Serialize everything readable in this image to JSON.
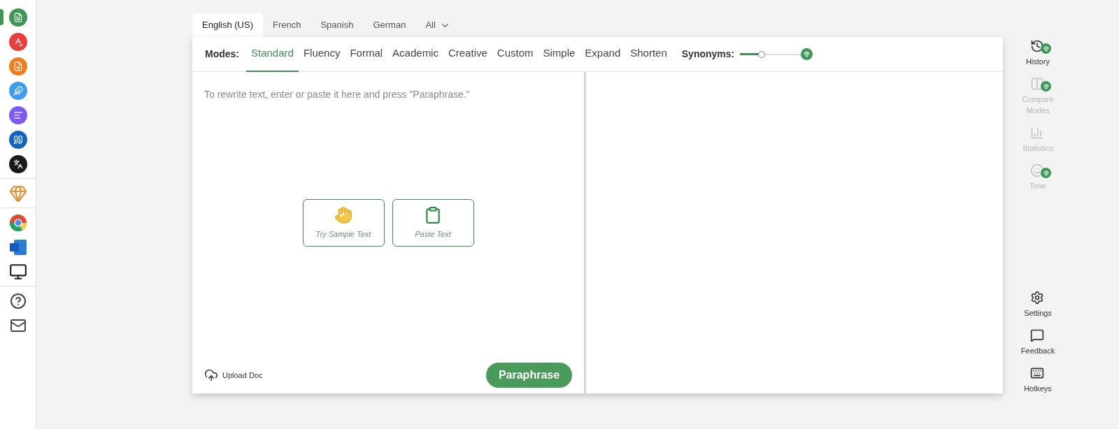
{
  "sidebar": {
    "groups": [
      {
        "items": [
          {
            "kind": "paraphraser",
            "selected": true
          },
          {
            "kind": "grammar",
            "selected": false
          },
          {
            "kind": "plagiarism",
            "selected": false
          },
          {
            "kind": "cowriter",
            "selected": false
          },
          {
            "kind": "summarizer",
            "selected": false
          },
          {
            "kind": "citation",
            "selected": false
          },
          {
            "kind": "translator",
            "selected": false
          }
        ]
      },
      {
        "items": [
          {
            "kind": "premium",
            "selected": false
          }
        ]
      },
      {
        "items": [
          {
            "kind": "chrome",
            "selected": false
          },
          {
            "kind": "word",
            "selected": false
          },
          {
            "kind": "desktop",
            "selected": false
          }
        ]
      },
      {
        "items": [
          {
            "kind": "help",
            "selected": false
          },
          {
            "kind": "mail",
            "selected": false
          }
        ]
      }
    ]
  },
  "language_tabs": [
    {
      "label": "English (US)",
      "selected": true
    },
    {
      "label": "French",
      "selected": false
    },
    {
      "label": "Spanish",
      "selected": false
    },
    {
      "label": "German",
      "selected": false
    },
    {
      "label": "All",
      "selected": false,
      "dropdown": true
    }
  ],
  "modes": {
    "label": "Modes:",
    "items": [
      {
        "label": "Standard",
        "selected": true
      },
      {
        "label": "Fluency",
        "selected": false
      },
      {
        "label": "Formal",
        "selected": false
      },
      {
        "label": "Academic",
        "selected": false
      },
      {
        "label": "Creative",
        "selected": false
      },
      {
        "label": "Custom",
        "selected": false
      },
      {
        "label": "Simple",
        "selected": false
      },
      {
        "label": "Expand",
        "selected": false
      },
      {
        "label": "Shorten",
        "selected": false
      }
    ]
  },
  "synonyms": {
    "label": "Synonyms:",
    "level": 0.33
  },
  "input": {
    "placeholder": "To rewrite text, enter or paste it here and press \"Paraphrase.\""
  },
  "quick_buttons": [
    {
      "kind": "sample",
      "label": "Try Sample Text"
    },
    {
      "kind": "paste",
      "label": "Paste Text"
    }
  ],
  "upload": {
    "label": "Upload Doc"
  },
  "paraphrase_button": {
    "label": "Paraphrase"
  },
  "tools": [
    {
      "kind": "history",
      "label": "History",
      "premium": true,
      "disabled": false
    },
    {
      "kind": "compare",
      "label": "Compare Modes",
      "premium": true,
      "disabled": true
    },
    {
      "kind": "statistics",
      "label": "Statistics",
      "premium": false,
      "disabled": true
    },
    {
      "kind": "tone",
      "label": "Tone",
      "premium": true,
      "disabled": true
    }
  ],
  "bottom_tools": [
    {
      "kind": "settings",
      "label": "Settings",
      "premium": false,
      "disabled": false
    },
    {
      "kind": "feedback",
      "label": "Feedback",
      "premium": false,
      "disabled": false
    },
    {
      "kind": "hotkeys",
      "label": "Hotkeys",
      "premium": false,
      "disabled": false
    }
  ]
}
